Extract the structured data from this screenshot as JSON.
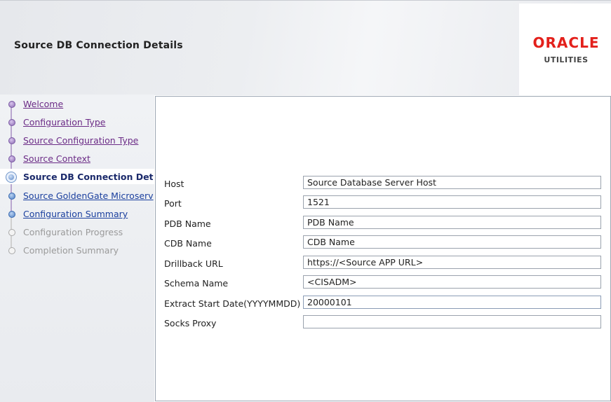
{
  "header": {
    "title": "Source DB Connection Details",
    "logo": {
      "brand": "ORACLE",
      "product": "UTILITIES",
      "brand_color": "#e3201b"
    }
  },
  "sidebar": {
    "items": [
      {
        "label": "Welcome",
        "state": "visited"
      },
      {
        "label": "Configuration Type",
        "state": "visited"
      },
      {
        "label": "Source Configuration Type",
        "state": "visited"
      },
      {
        "label": "Source Context",
        "state": "visited"
      },
      {
        "label": "Source DB Connection Det",
        "state": "current"
      },
      {
        "label": "Source GoldenGate Microserv",
        "state": "link"
      },
      {
        "label": "Configuration Summary",
        "state": "link"
      },
      {
        "label": "Configuration Progress",
        "state": "disabled"
      },
      {
        "label": "Completion Summary",
        "state": "disabled"
      }
    ]
  },
  "form": {
    "fields": [
      {
        "label": "Host",
        "value": "Source Database Server Host"
      },
      {
        "label": "Port",
        "value": "1521"
      },
      {
        "label": "PDB Name",
        "value": "PDB Name"
      },
      {
        "label": "CDB Name",
        "value": "CDB Name"
      },
      {
        "label": "Drillback URL",
        "value": "https://<Source APP URL>"
      },
      {
        "label": "Schema Name",
        "value": "<CISADM>"
      },
      {
        "label": "Extract Start Date(YYYYMMDD)",
        "value": "20000101"
      },
      {
        "label": "Socks Proxy",
        "value": ""
      }
    ]
  }
}
